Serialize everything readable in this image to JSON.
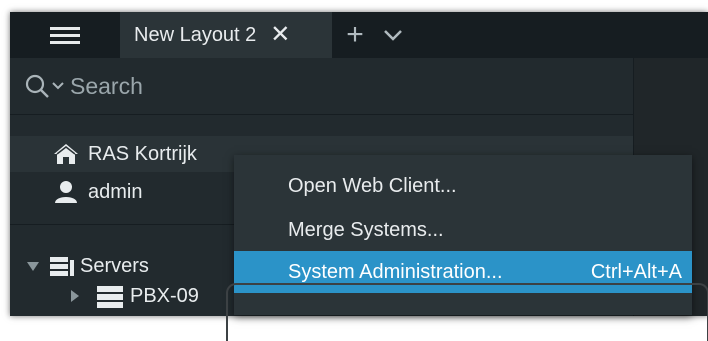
{
  "tabs": {
    "active_label": "New Layout 2",
    "close_glyph": "✕",
    "add_glyph": "+"
  },
  "search": {
    "placeholder": "Search"
  },
  "tree": {
    "system_name": "RAS Kortrijk",
    "user_name": "admin",
    "servers_label": "Servers",
    "server_items": [
      "PBX-09"
    ]
  },
  "context_menu": {
    "items": [
      {
        "label": "Open Web Client...",
        "shortcut": ""
      },
      {
        "label": "Merge Systems...",
        "shortcut": ""
      },
      {
        "label": "System Administration...",
        "shortcut": "Ctrl+Alt+A"
      }
    ]
  },
  "icons": {
    "menu": "hamburger-icon",
    "search": "search-icon",
    "home": "home-icon",
    "user": "user-icon",
    "servers": "servers-icon",
    "server": "server-icon"
  },
  "colors": {
    "background": "#222a2e",
    "topbar": "#161d21",
    "menu_bg": "#2b3438",
    "highlight": "#2b93c8",
    "text": "#e9ecee"
  }
}
